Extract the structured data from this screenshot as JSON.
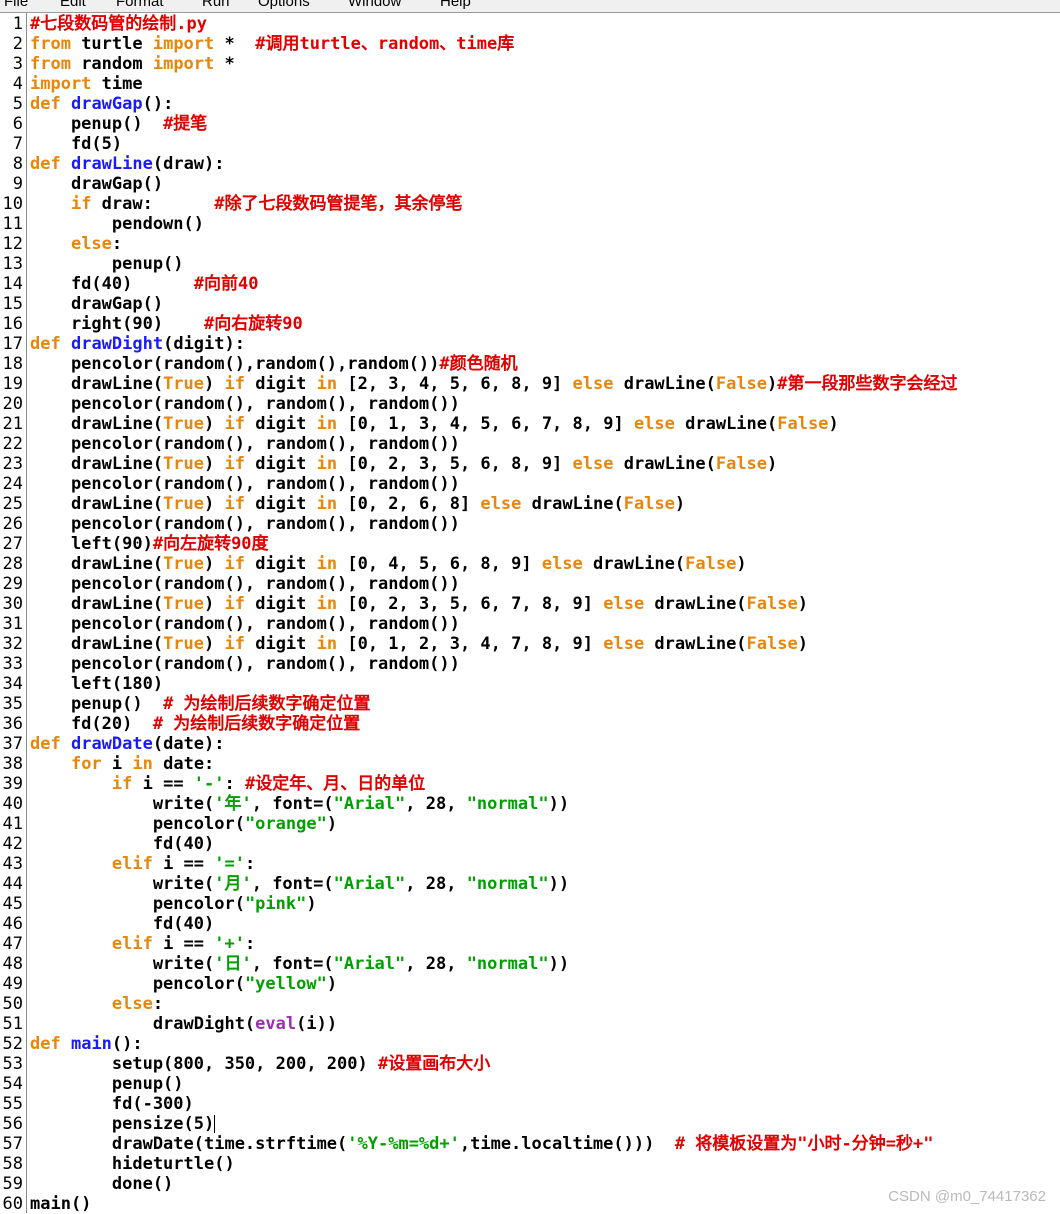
{
  "menu": [
    "File",
    "Edit",
    "Format",
    "Run",
    "Options",
    "Window",
    "Help"
  ],
  "watermark": "CSDN @m0_74417362",
  "colors": {
    "keyword": "#e8860c",
    "def_name": "#1a1aff",
    "comment": "#e00000",
    "string": "#00a000",
    "builtin": "#9b2fb0",
    "text": "#000000",
    "gutter_line": "#8a8a8a"
  },
  "lines": [
    [
      [
        "c",
        "#七段数码管的绘制.py"
      ]
    ],
    [
      [
        "k",
        "from"
      ],
      [
        "p",
        " turtle "
      ],
      [
        "k",
        "import"
      ],
      [
        "p",
        " *  "
      ],
      [
        "c",
        "#调用turtle、random、time库"
      ]
    ],
    [
      [
        "k",
        "from"
      ],
      [
        "p",
        " random "
      ],
      [
        "k",
        "import"
      ],
      [
        "p",
        " *"
      ]
    ],
    [
      [
        "k",
        "import"
      ],
      [
        "p",
        " time"
      ]
    ],
    [
      [
        "k",
        "def"
      ],
      [
        "p",
        " "
      ],
      [
        "d",
        "drawGap"
      ],
      [
        "p",
        "():"
      ]
    ],
    [
      [
        "p",
        "    penup()  "
      ],
      [
        "c",
        "#提笔"
      ]
    ],
    [
      [
        "p",
        "    fd(5)"
      ]
    ],
    [
      [
        "k",
        "def"
      ],
      [
        "p",
        " "
      ],
      [
        "d",
        "drawLine"
      ],
      [
        "p",
        "(draw):"
      ]
    ],
    [
      [
        "p",
        "    drawGap()"
      ]
    ],
    [
      [
        "p",
        "    "
      ],
      [
        "k",
        "if"
      ],
      [
        "p",
        " draw:      "
      ],
      [
        "c",
        "#除了七段数码管提笔，其余停笔"
      ]
    ],
    [
      [
        "p",
        "        pendown()"
      ]
    ],
    [
      [
        "p",
        "    "
      ],
      [
        "k",
        "else"
      ],
      [
        "p",
        ":"
      ]
    ],
    [
      [
        "p",
        "        penup()"
      ]
    ],
    [
      [
        "p",
        "    fd(40)      "
      ],
      [
        "c",
        "#向前40"
      ]
    ],
    [
      [
        "p",
        "    drawGap()"
      ]
    ],
    [
      [
        "p",
        "    right(90)    "
      ],
      [
        "c",
        "#向右旋转90"
      ]
    ],
    [
      [
        "k",
        "def"
      ],
      [
        "p",
        " "
      ],
      [
        "d",
        "drawDight"
      ],
      [
        "p",
        "(digit):"
      ]
    ],
    [
      [
        "p",
        "    pencolor(random(),random(),random())"
      ],
      [
        "c",
        "#颜色随机"
      ]
    ],
    [
      [
        "p",
        "    drawLine("
      ],
      [
        "k",
        "True"
      ],
      [
        "p",
        ") "
      ],
      [
        "k",
        "if"
      ],
      [
        "p",
        " digit "
      ],
      [
        "k",
        "in"
      ],
      [
        "p",
        " [2, 3, 4, 5, 6, 8, 9] "
      ],
      [
        "k",
        "else"
      ],
      [
        "p",
        " drawLine("
      ],
      [
        "k",
        "False"
      ],
      [
        "p",
        ")"
      ],
      [
        "c",
        "#第一段那些数字会经过"
      ]
    ],
    [
      [
        "p",
        "    pencolor(random(), random(), random())"
      ]
    ],
    [
      [
        "p",
        "    drawLine("
      ],
      [
        "k",
        "True"
      ],
      [
        "p",
        ") "
      ],
      [
        "k",
        "if"
      ],
      [
        "p",
        " digit "
      ],
      [
        "k",
        "in"
      ],
      [
        "p",
        " [0, 1, 3, 4, 5, 6, 7, 8, 9] "
      ],
      [
        "k",
        "else"
      ],
      [
        "p",
        " drawLine("
      ],
      [
        "k",
        "False"
      ],
      [
        "p",
        ")"
      ]
    ],
    [
      [
        "p",
        "    pencolor(random(), random(), random())"
      ]
    ],
    [
      [
        "p",
        "    drawLine("
      ],
      [
        "k",
        "True"
      ],
      [
        "p",
        ") "
      ],
      [
        "k",
        "if"
      ],
      [
        "p",
        " digit "
      ],
      [
        "k",
        "in"
      ],
      [
        "p",
        " [0, 2, 3, 5, 6, 8, 9] "
      ],
      [
        "k",
        "else"
      ],
      [
        "p",
        " drawLine("
      ],
      [
        "k",
        "False"
      ],
      [
        "p",
        ")"
      ]
    ],
    [
      [
        "p",
        "    pencolor(random(), random(), random())"
      ]
    ],
    [
      [
        "p",
        "    drawLine("
      ],
      [
        "k",
        "True"
      ],
      [
        "p",
        ") "
      ],
      [
        "k",
        "if"
      ],
      [
        "p",
        " digit "
      ],
      [
        "k",
        "in"
      ],
      [
        "p",
        " [0, 2, 6, 8] "
      ],
      [
        "k",
        "else"
      ],
      [
        "p",
        " drawLine("
      ],
      [
        "k",
        "False"
      ],
      [
        "p",
        ")"
      ]
    ],
    [
      [
        "p",
        "    pencolor(random(), random(), random())"
      ]
    ],
    [
      [
        "p",
        "    left(90)"
      ],
      [
        "c",
        "#向左旋转90度"
      ]
    ],
    [
      [
        "p",
        "    drawLine("
      ],
      [
        "k",
        "True"
      ],
      [
        "p",
        ") "
      ],
      [
        "k",
        "if"
      ],
      [
        "p",
        " digit "
      ],
      [
        "k",
        "in"
      ],
      [
        "p",
        " [0, 4, 5, 6, 8, 9] "
      ],
      [
        "k",
        "else"
      ],
      [
        "p",
        " drawLine("
      ],
      [
        "k",
        "False"
      ],
      [
        "p",
        ")"
      ]
    ],
    [
      [
        "p",
        "    pencolor(random(), random(), random())"
      ]
    ],
    [
      [
        "p",
        "    drawLine("
      ],
      [
        "k",
        "True"
      ],
      [
        "p",
        ") "
      ],
      [
        "k",
        "if"
      ],
      [
        "p",
        " digit "
      ],
      [
        "k",
        "in"
      ],
      [
        "p",
        " [0, 2, 3, 5, 6, 7, 8, 9] "
      ],
      [
        "k",
        "else"
      ],
      [
        "p",
        " drawLine("
      ],
      [
        "k",
        "False"
      ],
      [
        "p",
        ")"
      ]
    ],
    [
      [
        "p",
        "    pencolor(random(), random(), random())"
      ]
    ],
    [
      [
        "p",
        "    drawLine("
      ],
      [
        "k",
        "True"
      ],
      [
        "p",
        ") "
      ],
      [
        "k",
        "if"
      ],
      [
        "p",
        " digit "
      ],
      [
        "k",
        "in"
      ],
      [
        "p",
        " [0, 1, 2, 3, 4, 7, 8, 9] "
      ],
      [
        "k",
        "else"
      ],
      [
        "p",
        " drawLine("
      ],
      [
        "k",
        "False"
      ],
      [
        "p",
        ")"
      ]
    ],
    [
      [
        "p",
        "    pencolor(random(), random(), random())"
      ]
    ],
    [
      [
        "p",
        "    left(180)"
      ]
    ],
    [
      [
        "p",
        "    penup()  "
      ],
      [
        "c",
        "# 为绘制后续数字确定位置"
      ]
    ],
    [
      [
        "p",
        "    fd(20)  "
      ],
      [
        "c",
        "# 为绘制后续数字确定位置"
      ]
    ],
    [
      [
        "k",
        "def"
      ],
      [
        "p",
        " "
      ],
      [
        "d",
        "drawDate"
      ],
      [
        "p",
        "(date):"
      ]
    ],
    [
      [
        "p",
        "    "
      ],
      [
        "k",
        "for"
      ],
      [
        "p",
        " i "
      ],
      [
        "k",
        "in"
      ],
      [
        "p",
        " date:"
      ]
    ],
    [
      [
        "p",
        "        "
      ],
      [
        "k",
        "if"
      ],
      [
        "p",
        " i == "
      ],
      [
        "s",
        "'-'"
      ],
      [
        "p",
        ": "
      ],
      [
        "c",
        "#设定年、月、日的单位"
      ]
    ],
    [
      [
        "p",
        "            write("
      ],
      [
        "s",
        "'年'"
      ],
      [
        "p",
        ", font=("
      ],
      [
        "s",
        "\"Arial\""
      ],
      [
        "p",
        ", 28, "
      ],
      [
        "s",
        "\"normal\""
      ],
      [
        "p",
        "))"
      ]
    ],
    [
      [
        "p",
        "            pencolor("
      ],
      [
        "s",
        "\"orange\""
      ],
      [
        "p",
        ")"
      ]
    ],
    [
      [
        "p",
        "            fd(40)"
      ]
    ],
    [
      [
        "p",
        "        "
      ],
      [
        "k",
        "elif"
      ],
      [
        "p",
        " i == "
      ],
      [
        "s",
        "'='"
      ],
      [
        "p",
        ":"
      ]
    ],
    [
      [
        "p",
        "            write("
      ],
      [
        "s",
        "'月'"
      ],
      [
        "p",
        ", font=("
      ],
      [
        "s",
        "\"Arial\""
      ],
      [
        "p",
        ", 28, "
      ],
      [
        "s",
        "\"normal\""
      ],
      [
        "p",
        "))"
      ]
    ],
    [
      [
        "p",
        "            pencolor("
      ],
      [
        "s",
        "\"pink\""
      ],
      [
        "p",
        ")"
      ]
    ],
    [
      [
        "p",
        "            fd(40)"
      ]
    ],
    [
      [
        "p",
        "        "
      ],
      [
        "k",
        "elif"
      ],
      [
        "p",
        " i == "
      ],
      [
        "s",
        "'+'"
      ],
      [
        "p",
        ":"
      ]
    ],
    [
      [
        "p",
        "            write("
      ],
      [
        "s",
        "'日'"
      ],
      [
        "p",
        ", font=("
      ],
      [
        "s",
        "\"Arial\""
      ],
      [
        "p",
        ", 28, "
      ],
      [
        "s",
        "\"normal\""
      ],
      [
        "p",
        "))"
      ]
    ],
    [
      [
        "p",
        "            pencolor("
      ],
      [
        "s",
        "\"yellow\""
      ],
      [
        "p",
        ")"
      ]
    ],
    [
      [
        "p",
        "        "
      ],
      [
        "k",
        "else"
      ],
      [
        "p",
        ":"
      ]
    ],
    [
      [
        "p",
        "            drawDight("
      ],
      [
        "b",
        "eval"
      ],
      [
        "p",
        "(i))"
      ]
    ],
    [
      [
        "k",
        "def"
      ],
      [
        "p",
        " "
      ],
      [
        "d",
        "main"
      ],
      [
        "p",
        "():"
      ]
    ],
    [
      [
        "p",
        "        setup(800, 350, 200, 200) "
      ],
      [
        "c",
        "#设置画布大小"
      ]
    ],
    [
      [
        "p",
        "        penup()"
      ]
    ],
    [
      [
        "p",
        "        fd(-300)"
      ]
    ],
    [
      [
        "p",
        "        pensize(5)"
      ]
    ],
    [
      [
        "p",
        "        drawDate(time.strftime("
      ],
      [
        "s",
        "'%Y-%m=%d+'"
      ],
      [
        "p",
        ",time.localtime()))  "
      ],
      [
        "c",
        "# 将模板设置为\"小时-分钟=秒+\""
      ]
    ],
    [
      [
        "p",
        "        hideturtle()"
      ]
    ],
    [
      [
        "p",
        "        done()"
      ]
    ],
    [
      [
        "p",
        "main()"
      ]
    ]
  ]
}
